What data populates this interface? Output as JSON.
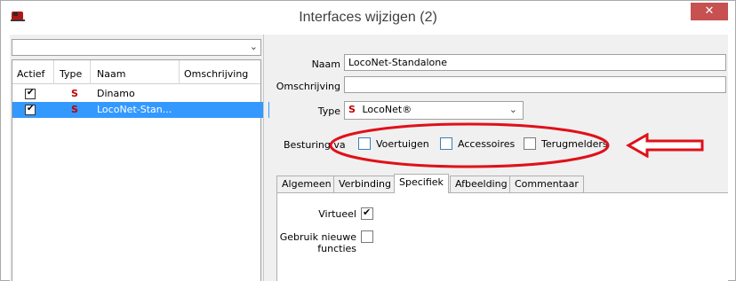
{
  "window": {
    "title": "Interfaces wijzigen (2)",
    "close_glyph": "✕"
  },
  "list": {
    "combo_value": "",
    "columns": [
      "Actief",
      "Type",
      "Naam",
      "Omschrijving"
    ],
    "rows": [
      {
        "active": true,
        "type": "S",
        "name": "Dinamo",
        "description": ""
      },
      {
        "active": true,
        "type": "S",
        "name": "LocoNet-Stan...",
        "description": ""
      }
    ]
  },
  "form": {
    "naam_label": "Naam",
    "naam_value": "LocoNet-Standalone",
    "omschrijving_label": "Omschrijving",
    "omschrijving_value": "",
    "type_label": "Type",
    "type_prefix": "S",
    "type_value": "LocoNet®",
    "besturing_label": "Besturing va",
    "voertuigen_label": "Voertuigen",
    "accessoires_label": "Accessoires",
    "terugmelders_label": "Terugmelders"
  },
  "tabs": [
    "Algemeen",
    "Verbinding",
    "Specifiek",
    "Afbeelding",
    "Commentaar"
  ],
  "active_tab": "Specifiek",
  "specifiek": {
    "virtueel_label": "Virtueel",
    "virtueel_checked": true,
    "nieuwe_label": "Gebruik nieuwe functies",
    "nieuwe_checked": false
  },
  "colors": {
    "selection": "#3399ff",
    "annotation_red": "#e0101a",
    "close_red": "#c75050"
  }
}
